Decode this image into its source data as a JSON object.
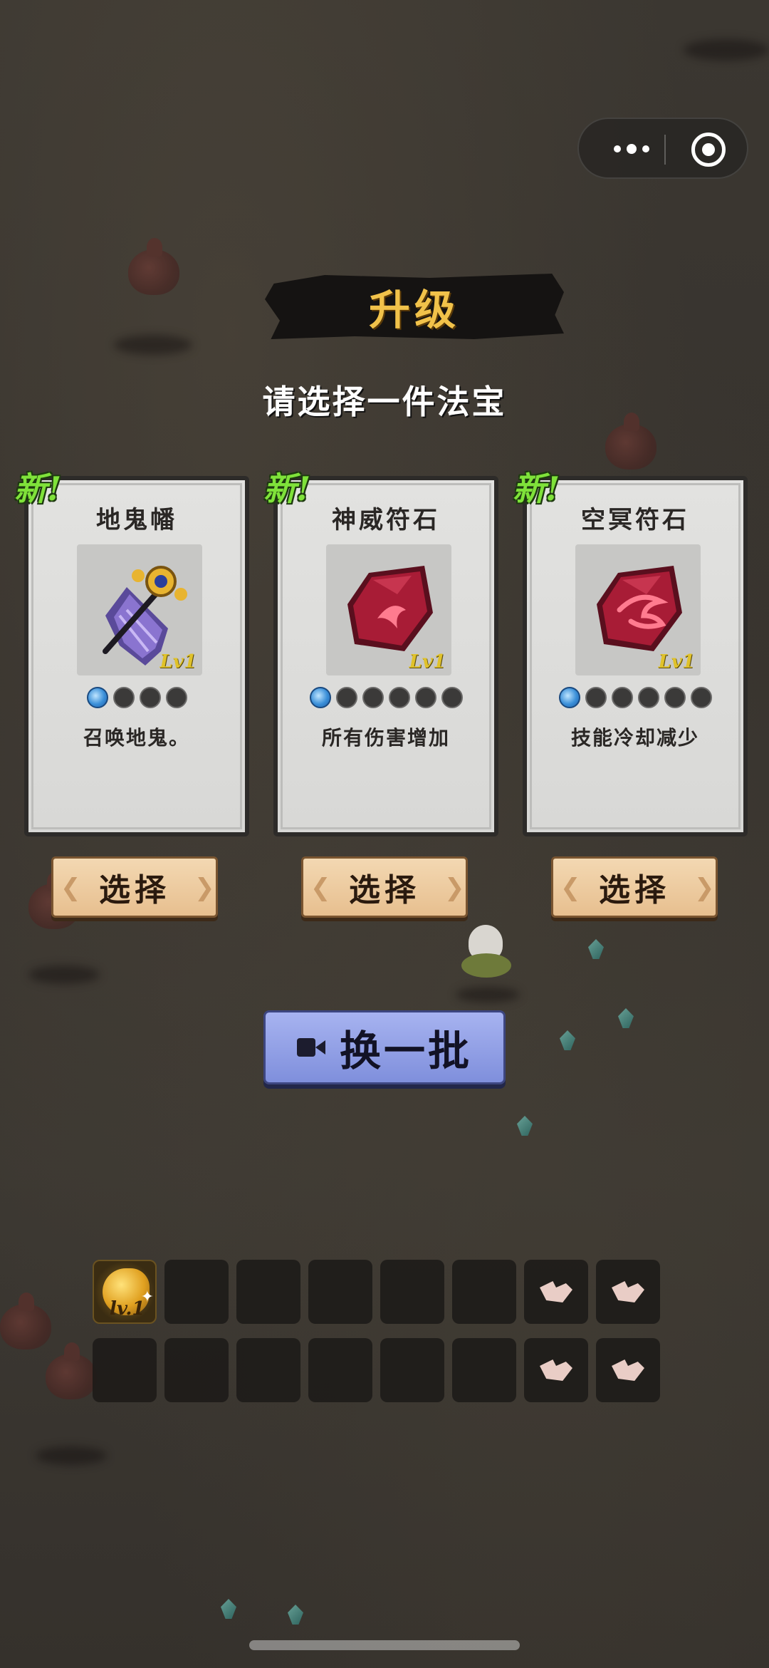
{
  "title": "升级",
  "subtitle": "请选择一件法宝",
  "cards": [
    {
      "badge": "新!",
      "name": "地鬼幡",
      "icon": "purple-banner-icon",
      "level": "Lv1",
      "stars_filled": 1,
      "stars_total": 4,
      "description": "召唤地鬼。"
    },
    {
      "badge": "新!",
      "name": "神威符石",
      "icon": "red-rune-stone-icon",
      "level": "Lv1",
      "stars_filled": 1,
      "stars_total": 6,
      "description": "所有伤害增加"
    },
    {
      "badge": "新!",
      "name": "空冥符石",
      "icon": "red-rune-stone-swirl-icon",
      "level": "Lv1",
      "stars_filled": 1,
      "stars_total": 6,
      "description": "技能冷却减少"
    }
  ],
  "select_label": "选择",
  "refresh": {
    "label": "换一批",
    "icon": "video-ad-icon"
  },
  "inventory": {
    "rows": [
      [
        "equipped",
        "empty",
        "empty",
        "empty",
        "empty",
        "empty",
        "locked",
        "locked"
      ],
      [
        "empty",
        "empty",
        "empty",
        "empty",
        "empty",
        "empty",
        "locked",
        "locked"
      ]
    ],
    "equipped_level": "lv.1"
  },
  "colors": {
    "title": "#f1c24a",
    "new_badge": "#7fe23a",
    "level": "#e0c22a",
    "select_button": "#e7bf8f",
    "refresh_button": "#8f9de4"
  }
}
